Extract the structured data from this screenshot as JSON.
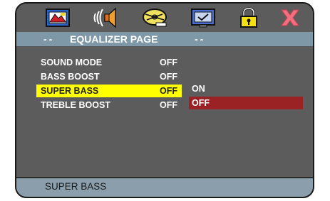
{
  "tabs": [
    {
      "icon": "flag-icon"
    },
    {
      "icon": "speaker-sound-icon"
    },
    {
      "icon": "disc-film-icon"
    },
    {
      "icon": "monitor-check-icon"
    },
    {
      "icon": "lock-icon"
    },
    {
      "icon": "close-x-icon"
    }
  ],
  "header": {
    "dash_left": "--",
    "title": "EQUALIZER PAGE",
    "dash_right": "--"
  },
  "menu": [
    {
      "label": "SOUND MODE",
      "value": "OFF"
    },
    {
      "label": "BASS BOOST",
      "value": "OFF"
    },
    {
      "label": "SUPER BASS",
      "value": "OFF",
      "selected": true
    },
    {
      "label": "TREBLE BOOST",
      "value": "OFF"
    }
  ],
  "options": [
    {
      "label": "ON"
    },
    {
      "label": "OFF",
      "active": true
    }
  ],
  "status": {
    "text": "SUPER BASS"
  },
  "colors": {
    "panel": "#5c5c5c",
    "header": "#7e98a8",
    "selected_row": "#ffff00",
    "active_option": "#9a2224",
    "status_bar": "#8a9eab"
  }
}
